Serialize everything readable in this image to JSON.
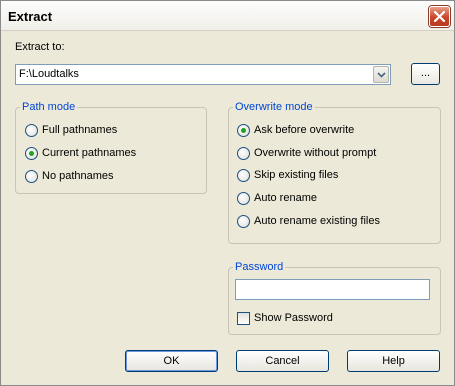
{
  "window": {
    "title": "Extract"
  },
  "extract_to": {
    "label": "Extract to:",
    "value": "F:\\Loudtalks",
    "browse_label": "..."
  },
  "path_mode": {
    "legend": "Path mode",
    "options": [
      {
        "label": "Full pathnames",
        "checked": false
      },
      {
        "label": "Current pathnames",
        "checked": true
      },
      {
        "label": "No pathnames",
        "checked": false
      }
    ]
  },
  "overwrite_mode": {
    "legend": "Overwrite mode",
    "options": [
      {
        "label": "Ask before overwrite",
        "checked": true
      },
      {
        "label": "Overwrite without prompt",
        "checked": false
      },
      {
        "label": "Skip existing files",
        "checked": false
      },
      {
        "label": "Auto rename",
        "checked": false
      },
      {
        "label": "Auto rename existing files",
        "checked": false
      }
    ]
  },
  "password": {
    "legend": "Password",
    "value": "",
    "show_password_label": "Show Password",
    "show_password_checked": false
  },
  "buttons": {
    "ok": "OK",
    "cancel": "Cancel",
    "help": "Help"
  },
  "colors": {
    "group_legend": "#0046d5",
    "radio_selected": "#21a121",
    "close_button": "#c9462a"
  }
}
